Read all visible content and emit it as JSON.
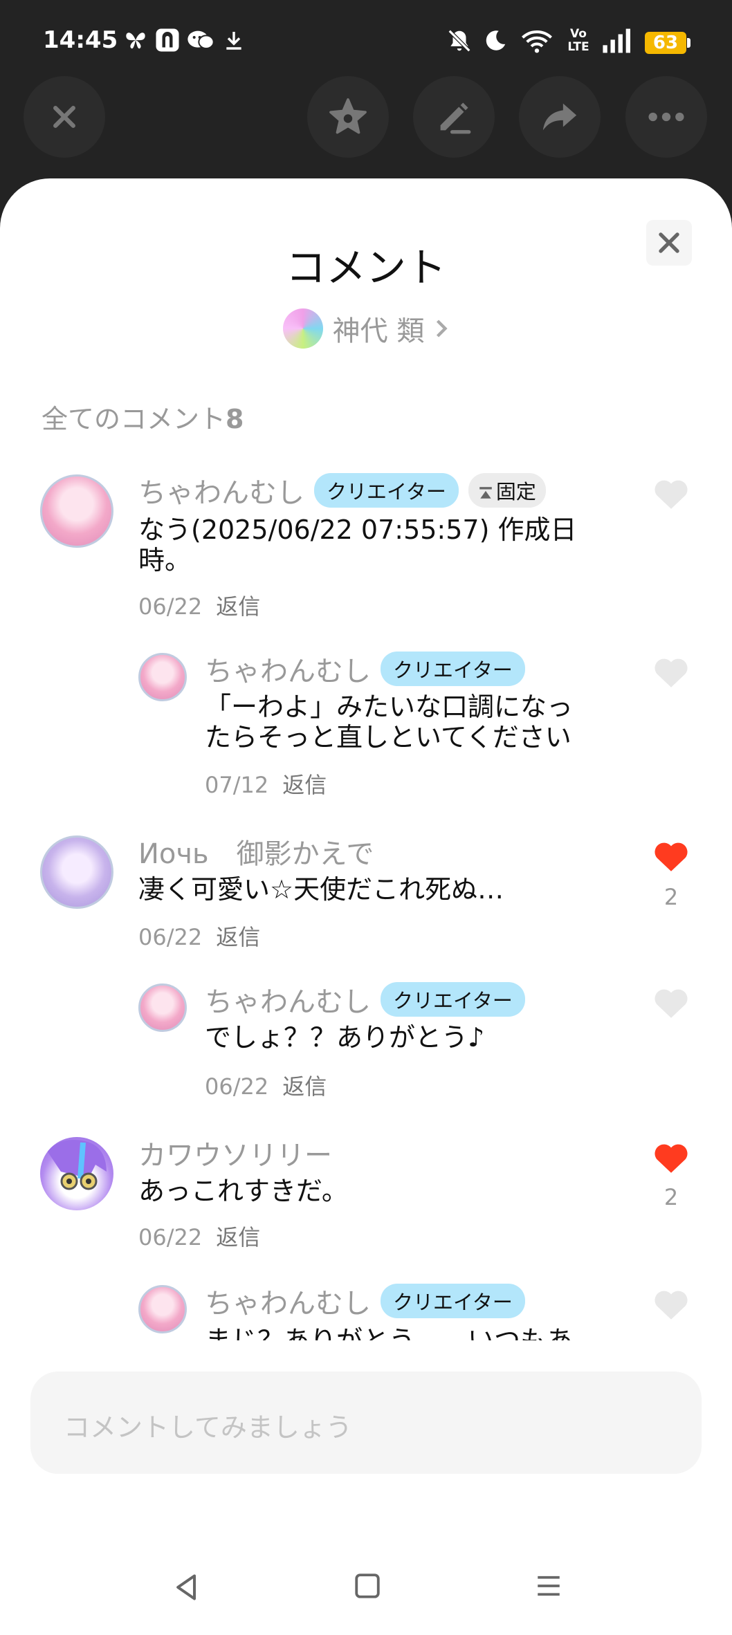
{
  "status_bar": {
    "time": "14:45",
    "battery": "63",
    "left_icons": [
      "butterfly-icon",
      "app-icon",
      "chat-icon",
      "download-icon"
    ],
    "right_icons": [
      "mute-icon",
      "moon-icon",
      "wifi-icon",
      "volte-icon",
      "signal-icon"
    ],
    "volte_label_top": "Vo",
    "volte_label_bottom": "LTE"
  },
  "top_bar": {
    "buttons": [
      "close-icon",
      "star-icon",
      "edit-icon",
      "share-icon",
      "more-icon"
    ]
  },
  "sheet": {
    "title": "コメント",
    "author_name": "神代 類",
    "count_label": "全てのコメント",
    "count": "8"
  },
  "comments": [
    {
      "user": "ちゃわんむし",
      "badge": "クリエイター",
      "pinned_label": "固定",
      "text_line1": "なう(2025/06/22 07:55:57)  作成日",
      "text_line2": "時。",
      "date": "06/22",
      "reply_label": "返信",
      "liked": false,
      "likes": ""
    },
    {
      "user": "ちゃわんむし",
      "badge": "クリエイター",
      "text_line1": "「ーわよ」みたいな口調になっ",
      "text_line2": "たらそっと直しといてください",
      "date": "07/12",
      "reply_label": "返信",
      "liked": false,
      "likes": ""
    },
    {
      "user": "Иочь　御影かえで",
      "text_line1": "凄く可愛い☆天使だこれ死ぬ…",
      "date": "06/22",
      "reply_label": "返信",
      "liked": true,
      "likes": "2"
    },
    {
      "user": "ちゃわんむし",
      "badge": "クリエイター",
      "text_line1": "でしょ？？ありがとう♪",
      "date": "06/22",
      "reply_label": "返信",
      "liked": false,
      "likes": ""
    },
    {
      "user": "カワウソリリー",
      "text_line1": "あっこれすきだ。",
      "date": "06/22",
      "reply_label": "返信",
      "liked": true,
      "likes": "2"
    },
    {
      "user": "ちゃわんむし",
      "badge": "クリエイター",
      "text_line1": "まじ？ありがとう……いつもあ",
      "liked": false,
      "likes": ""
    }
  ],
  "input": {
    "placeholder": "コメントしてみましょう"
  },
  "colors": {
    "like_active": "#ff3b1f",
    "like_inactive": "#e8e8e8",
    "creator_badge": "#b3e6fb"
  }
}
